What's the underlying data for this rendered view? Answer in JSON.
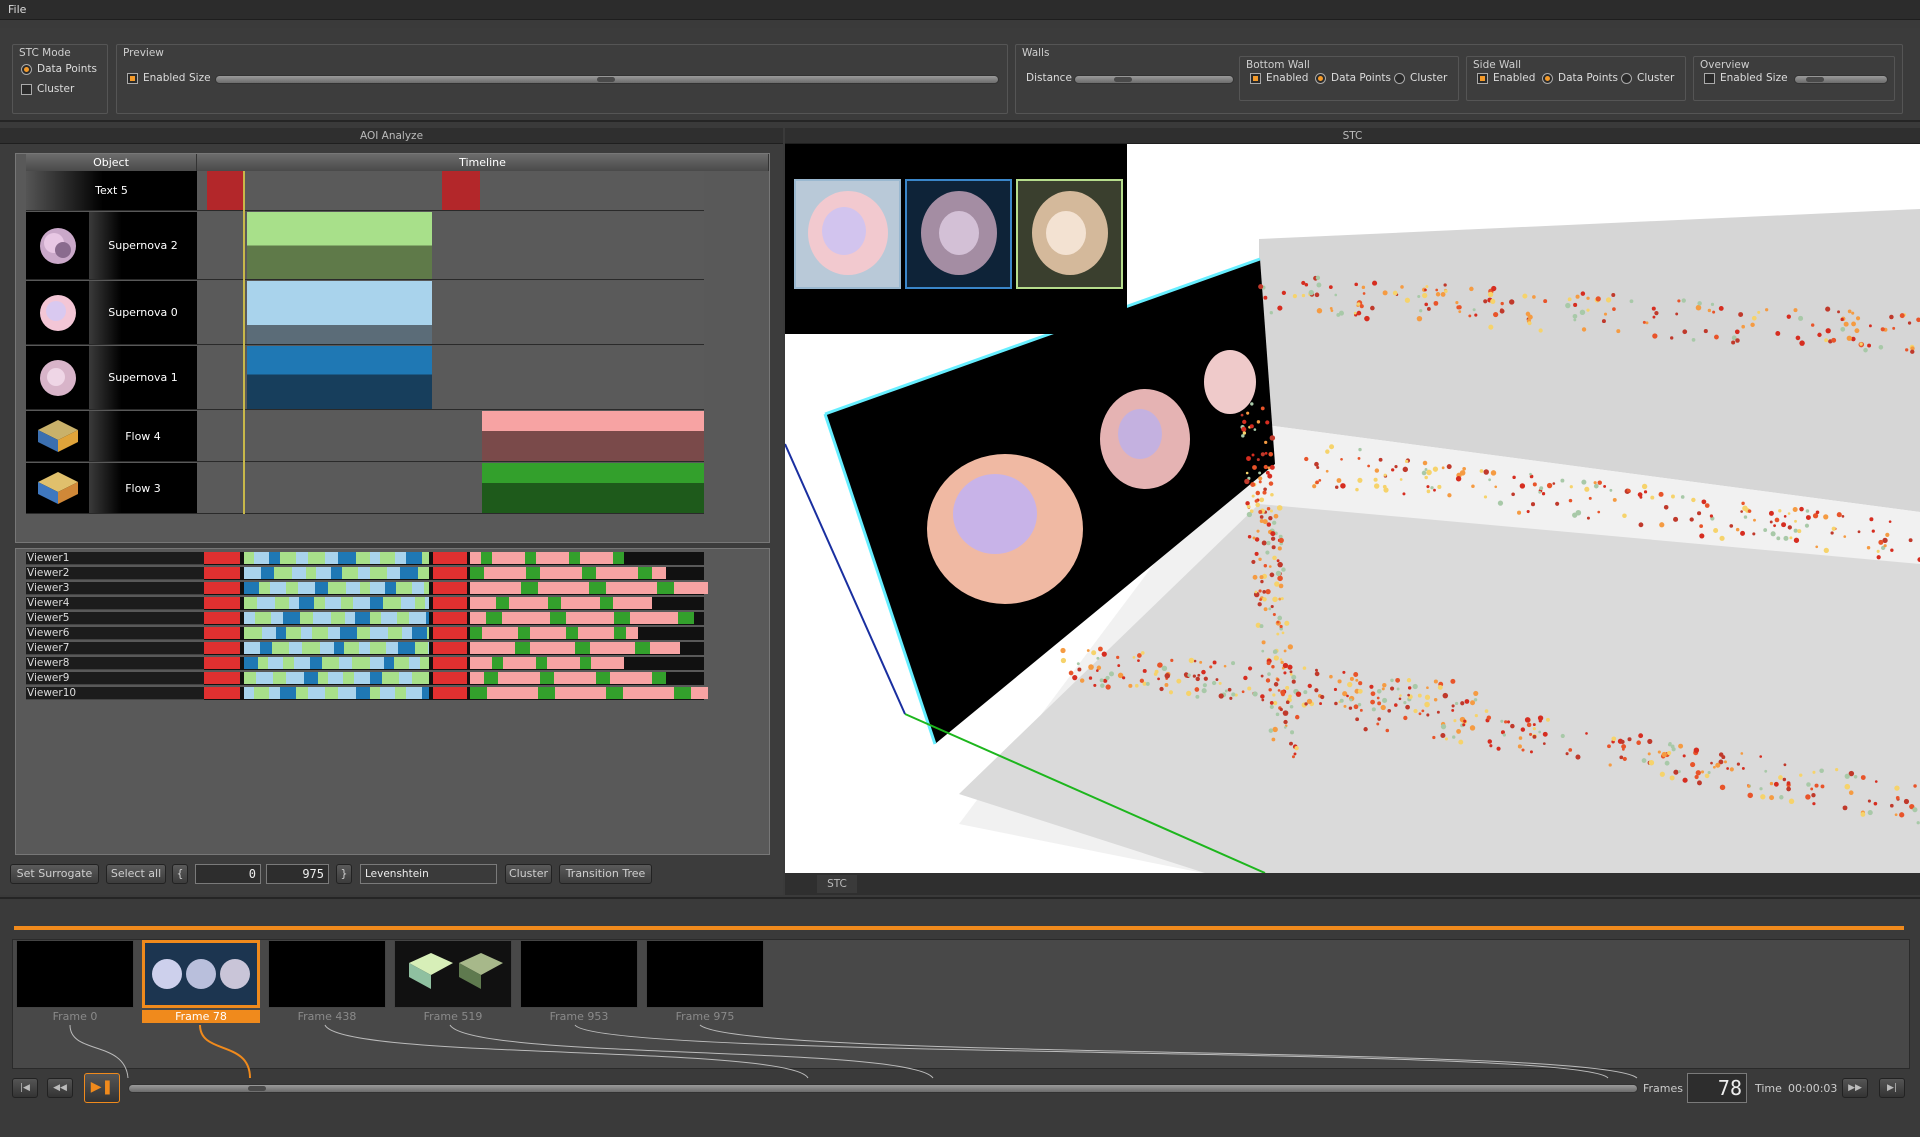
{
  "menu": {
    "file": "File"
  },
  "toolbar": {
    "stc_mode": {
      "title": "STC Mode",
      "data_points": "Data Points",
      "cluster": "Cluster"
    },
    "preview": {
      "title": "Preview",
      "enabled": "Enabled",
      "size": "Size",
      "size_value": 0.5
    },
    "walls": {
      "title": "Walls",
      "distance": "Distance",
      "distance_value": 0.28
    },
    "bottom_wall": {
      "title": "Bottom Wall",
      "enabled": "Enabled",
      "data_points": "Data Points",
      "cluster": "Cluster"
    },
    "side_wall": {
      "title": "Side Wall",
      "enabled": "Enabled",
      "data_points": "Data Points",
      "cluster": "Cluster"
    },
    "overview": {
      "title": "Overview",
      "enabled": "Enabled",
      "size": "Size",
      "size_value": 0.15
    }
  },
  "aoi": {
    "title": "AOI Analyze",
    "col_object": "Object",
    "col_timeline": "Timeline",
    "objects": [
      {
        "name": "Text 5",
        "thumb": "none"
      },
      {
        "name": "Supernova 2",
        "thumb": "supernova-thumbnail"
      },
      {
        "name": "Supernova 0",
        "thumb": "supernova-thumbnail"
      },
      {
        "name": "Supernova 1",
        "thumb": "supernova-thumbnail"
      },
      {
        "name": "Flow 4",
        "thumb": "flow-thumbnail"
      },
      {
        "name": "Flow 3",
        "thumb": "flow-thumbnail"
      }
    ],
    "obj_colors": {
      "text5": "#b3272a",
      "sn2": "#a8e08a",
      "sn0": "#a9d3ec",
      "sn1": "#1f78b4",
      "flow4": "#f7a3a3",
      "flow3": "#33a02c"
    },
    "viewers": [
      "Viewer1",
      "Viewer2",
      "Viewer3",
      "Viewer4",
      "Viewer5",
      "Viewer6",
      "Viewer7",
      "Viewer8",
      "Viewer9",
      "Viewer10"
    ],
    "controls": {
      "set_surrogate": "Set Surrogate",
      "select_all": "Select all",
      "open_brace": "{",
      "close_brace": "}",
      "from": "0",
      "to": "975",
      "metric": "Levenshtein",
      "cluster": "Cluster",
      "transition_tree": "Transition Tree"
    }
  },
  "stc": {
    "title": "STC",
    "tab": "STC"
  },
  "timeline": {
    "frames": [
      {
        "label": "Frame 0",
        "content": "black"
      },
      {
        "label": "Frame 78",
        "content": "supernovae",
        "selected": true
      },
      {
        "label": "Frame 438",
        "content": "black"
      },
      {
        "label": "Frame 519",
        "content": "flows"
      },
      {
        "label": "Frame 953",
        "content": "black"
      },
      {
        "label": "Frame 975",
        "content": "black"
      }
    ],
    "frames_label": "Frames",
    "frame_value": "78",
    "time_label": "Time",
    "time_value": "00:00:03",
    "progress": 0.08
  }
}
